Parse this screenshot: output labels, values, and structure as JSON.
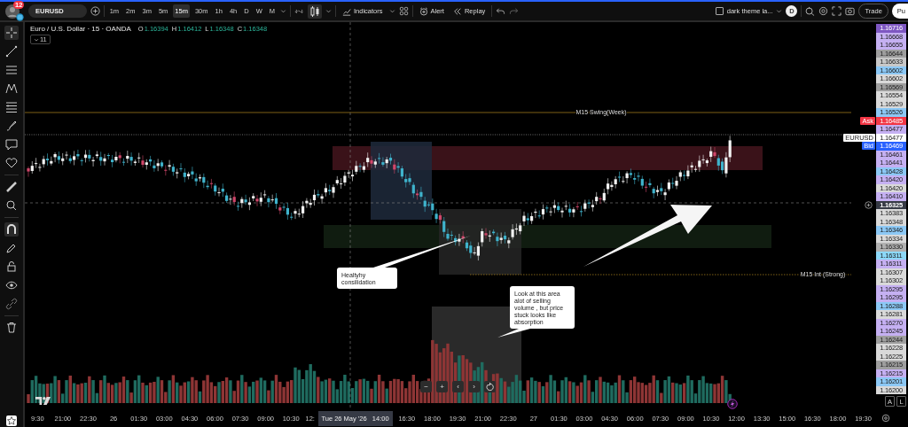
{
  "toolbar": {
    "badge": "12",
    "symbol": "EURUSD",
    "intervals": [
      {
        "label": "1m",
        "selected": false
      },
      {
        "label": "2m",
        "selected": false
      },
      {
        "label": "3m",
        "selected": false
      },
      {
        "label": "5m",
        "selected": false
      },
      {
        "label": "15m",
        "selected": true
      },
      {
        "label": "30m",
        "selected": false
      },
      {
        "label": "1h",
        "selected": false
      },
      {
        "label": "4h",
        "selected": false
      },
      {
        "label": "D",
        "selected": false
      },
      {
        "label": "W",
        "selected": false
      },
      {
        "label": "M",
        "selected": false
      }
    ],
    "indicators": "Indicators",
    "alert": "Alert",
    "replay": "Replay",
    "layout_checked": false,
    "layout_name": "dark theme la...",
    "account_initial": "D",
    "trade": "Trade",
    "publish": "Pu"
  },
  "legend": {
    "title": "Euro / U.S. Dollar · 15 · OANDA",
    "ohlc": [
      {
        "key": "O",
        "value": "1.16394"
      },
      {
        "key": "H",
        "value": "1.16412"
      },
      {
        "key": "L",
        "value": "1.16348"
      },
      {
        "key": "C",
        "value": "1.16348"
      }
    ],
    "indicator_count": "11"
  },
  "levels": [
    {
      "label": "M15 Swing(Week)"
    },
    {
      "label": "M15 Int (Strong)"
    }
  ],
  "callouts": [
    {
      "text": "Healtyhy consilidation"
    },
    {
      "text": "Look at this area alot of selling volume , but price stuck looks like absorption"
    }
  ],
  "chart_nav": [
    "−",
    "+",
    "‹",
    "›"
  ],
  "price_scale": [
    {
      "kind": "plain",
      "text": "1.16716",
      "color": "#7e57c2"
    },
    {
      "kind": "plain",
      "text": "1.16668",
      "color": "#c5b0f2"
    },
    {
      "kind": "plain",
      "text": "1.16655",
      "color": "#c5b0f2"
    },
    {
      "kind": "plain",
      "text": "1.16644",
      "color": "#9e9e9e"
    },
    {
      "kind": "plain",
      "text": "1.16633",
      "color": "#c8c8c8"
    },
    {
      "kind": "plain",
      "text": "1.16602",
      "color": "#8cc8f5"
    },
    {
      "kind": "plain",
      "text": "1.16602",
      "color": "#d9d9d9"
    },
    {
      "kind": "plain",
      "text": "1.16569",
      "color": "#9e9e9e"
    },
    {
      "kind": "plain",
      "text": "1.16554",
      "color": "#d9d9d9"
    },
    {
      "kind": "plain",
      "text": "1.16529",
      "color": "#d9d9d9"
    },
    {
      "kind": "plain",
      "text": "1.16526",
      "color": "#8cc8f5"
    },
    {
      "kind": "tagged",
      "tag": "Ask",
      "text": "1.16485",
      "color": "#f23645"
    },
    {
      "kind": "plain",
      "text": "1.16477",
      "color": "#c5b0f2"
    },
    {
      "kind": "tagged",
      "tag": "EURUSD",
      "text": "1.16477",
      "color": "#ffffff"
    },
    {
      "kind": "tagged",
      "tag": "Bid",
      "text": "1.16469",
      "color": "#2962ff"
    },
    {
      "kind": "plain",
      "text": "1.16461",
      "color": "#c5b0f2"
    },
    {
      "kind": "plain",
      "text": "1.16441",
      "color": "#c5b0f2"
    },
    {
      "kind": "plain",
      "text": "1.16428",
      "color": "#8cc8f5"
    },
    {
      "kind": "plain",
      "text": "1.16420",
      "color": "#c5b0f2"
    },
    {
      "kind": "plain",
      "text": "1.16420",
      "color": "#d9d9d9"
    },
    {
      "kind": "plain",
      "text": "1.16410",
      "color": "#c5b0f2"
    },
    {
      "kind": "crosshair",
      "text": "1.16325",
      "color": "#363a45"
    },
    {
      "kind": "plain",
      "text": "1.16383",
      "color": "#d9d9d9"
    },
    {
      "kind": "plain",
      "text": "1.16348",
      "color": "#d9d9d9"
    },
    {
      "kind": "plain",
      "text": "1.16346",
      "color": "#8cc8f5"
    },
    {
      "kind": "plain",
      "text": "1.16334",
      "color": "#d9d9d9"
    },
    {
      "kind": "plain",
      "text": "1.16330",
      "color": "#b0b0b0"
    },
    {
      "kind": "plain",
      "text": "1.16311",
      "color": "#8cd8f8"
    },
    {
      "kind": "plain",
      "text": "1.16311",
      "color": "#c5b0f2"
    },
    {
      "kind": "plain",
      "text": "1.16307",
      "color": "#d9d9d9"
    },
    {
      "kind": "plain",
      "text": "1.16302",
      "color": "#d9d9d9"
    },
    {
      "kind": "plain",
      "text": "1.16295",
      "color": "#c5b0f2"
    },
    {
      "kind": "plain",
      "text": "1.16295",
      "color": "#c5b0f2"
    },
    {
      "kind": "plain",
      "text": "1.16288",
      "color": "#8cc8f5"
    },
    {
      "kind": "plain",
      "text": "1.16281",
      "color": "#d9d9d9"
    },
    {
      "kind": "plain",
      "text": "1.16270",
      "color": "#c5b0f2"
    },
    {
      "kind": "plain",
      "text": "1.16245",
      "color": "#c5b0f2"
    },
    {
      "kind": "plain",
      "text": "1.16244",
      "color": "#9e9e9e"
    },
    {
      "kind": "plain",
      "text": "1.16228",
      "color": "#d9d9d9"
    },
    {
      "kind": "plain",
      "text": "1.16225",
      "color": "#d9d9d9"
    },
    {
      "kind": "plain",
      "text": "1.16215",
      "color": "#9e9e9e"
    },
    {
      "kind": "plain",
      "text": "1.16215",
      "color": "#c5b0f2"
    },
    {
      "kind": "plain",
      "text": "1.16201",
      "color": "#8cc8f5"
    },
    {
      "kind": "plain",
      "text": "1.16200",
      "color": "#d9d9d9"
    }
  ],
  "scale_buttons": [
    "A",
    "L"
  ],
  "time_scale": [
    {
      "kind": "tick",
      "text": "9:30"
    },
    {
      "kind": "tick",
      "text": "21:00"
    },
    {
      "kind": "tick",
      "text": "22:30"
    },
    {
      "kind": "tick",
      "text": "26"
    },
    {
      "kind": "tick",
      "text": "01:30"
    },
    {
      "kind": "tick",
      "text": "03:00"
    },
    {
      "kind": "tick",
      "text": "04:30"
    },
    {
      "kind": "tick",
      "text": "06:00"
    },
    {
      "kind": "tick",
      "text": "07:30"
    },
    {
      "kind": "tick",
      "text": "09:00"
    },
    {
      "kind": "tick",
      "text": "10:30"
    },
    {
      "kind": "cut",
      "text": "12:"
    },
    {
      "kind": "crosshair",
      "text": "Tue 26 May '26   14:00"
    },
    {
      "kind": "tick",
      "text": "16:30"
    },
    {
      "kind": "tick",
      "text": "18:00"
    },
    {
      "kind": "tick",
      "text": "19:30"
    },
    {
      "kind": "tick",
      "text": "21:00"
    },
    {
      "kind": "tick",
      "text": "22:30"
    },
    {
      "kind": "tick",
      "text": "27"
    },
    {
      "kind": "tick",
      "text": "01:30"
    },
    {
      "kind": "tick",
      "text": "03:00"
    },
    {
      "kind": "tick",
      "text": "04:30"
    },
    {
      "kind": "tick",
      "text": "06:00"
    },
    {
      "kind": "tick",
      "text": "07:30"
    },
    {
      "kind": "tick",
      "text": "09:00"
    },
    {
      "kind": "tick",
      "text": "10:30"
    },
    {
      "kind": "tick",
      "text": "12:00"
    },
    {
      "kind": "tick",
      "text": "13:30"
    },
    {
      "kind": "tick",
      "text": "15:00"
    },
    {
      "kind": "tick",
      "text": "16:30"
    },
    {
      "kind": "tick",
      "text": "18:00"
    },
    {
      "kind": "tick",
      "text": "19:30"
    }
  ]
}
